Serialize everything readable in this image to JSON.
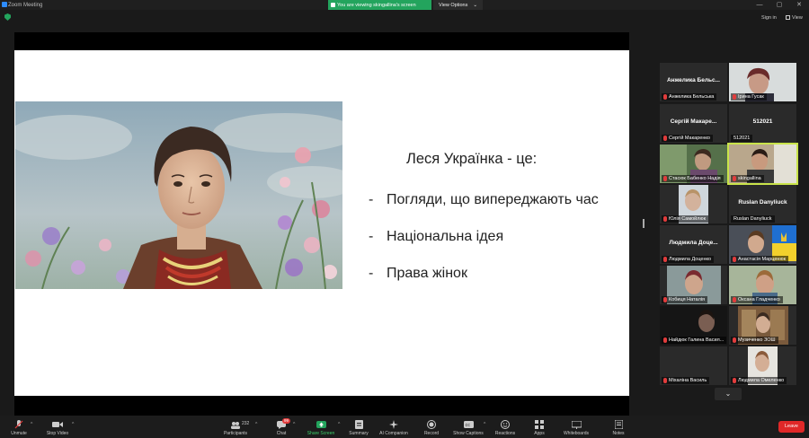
{
  "titlebar": {
    "app_title": "Zoom Meeting",
    "share_banner": "You are viewing skingallina's screen",
    "view_options": "View Options",
    "view_options_caret": "⌄",
    "minimize": "—",
    "maximize": "▢",
    "close": "✕"
  },
  "topbar": {
    "sign_in": "Sign in",
    "view": "View"
  },
  "slide": {
    "title": "Леся Українка - це:",
    "bullet_dash": "-",
    "bullets": [
      "Погляди, що випереджають час",
      "Національна ідея",
      "Права жінок"
    ]
  },
  "gallery": {
    "scroll_down": "⌄",
    "tiles": [
      {
        "center_name": "Анжелика Бельс...",
        "label": "Анжелика Бельськa"
      },
      {
        "center_name": "",
        "label": "Ірина Гусак"
      },
      {
        "center_name": "Сергій Макаре...",
        "label": "Сергій Макаренко"
      },
      {
        "center_name": "512021",
        "label": "512021"
      },
      {
        "center_name": "",
        "label": "Стасюк Бабенко Надія"
      },
      {
        "center_name": "",
        "label": "skingallina"
      },
      {
        "center_name": "",
        "label": "Юлія Самойлюк"
      },
      {
        "center_name": "Ruslan Danyliuck",
        "label": "Ruslan Danyliuck"
      },
      {
        "center_name": "Людмила Доце...",
        "label": "Людмила Доценко"
      },
      {
        "center_name": "",
        "label": "Анастасія Марценюк"
      },
      {
        "center_name": "",
        "label": "Кобиця Наталія"
      },
      {
        "center_name": "",
        "label": "Оксана Гладченко"
      },
      {
        "center_name": "",
        "label": "Найдюк Галина Васил..."
      },
      {
        "center_name": "",
        "label": "Музиченко ЗОШ"
      },
      {
        "center_name": "",
        "label": "Міхаліна Василь"
      },
      {
        "center_name": "",
        "label": "Людмила Омеленко"
      }
    ]
  },
  "toolbar": {
    "unmute": "Unmute",
    "stop_video": "Stop Video",
    "participants": "Participants",
    "participants_count": "232",
    "chat": "Chat",
    "chat_badge": "99",
    "share_screen": "Share Screen",
    "summary": "Summary",
    "ai_companion": "AI Companion",
    "record": "Record",
    "show_captions": "Show Captions",
    "reactions": "Reactions",
    "apps": "Apps",
    "whiteboards": "Whiteboards",
    "notes": "Notes",
    "leave": "Leave",
    "caret": "^"
  },
  "colors": {
    "share_green": "#23a45d",
    "speaker_outline": "#c9e34a",
    "leave_red": "#e02828"
  }
}
